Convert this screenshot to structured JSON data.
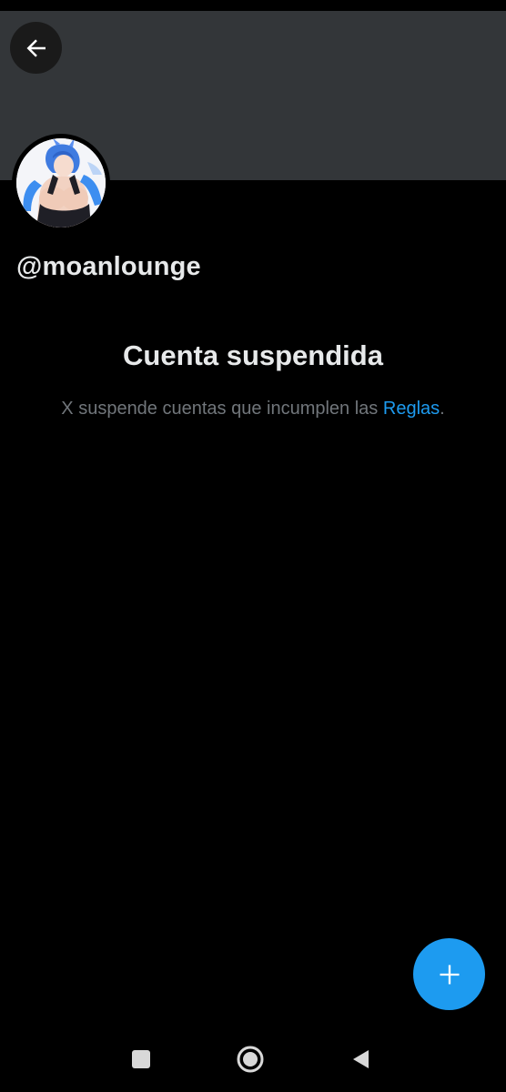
{
  "header": {
    "back_icon": "arrow-left-icon"
  },
  "profile": {
    "handle": "@moanlounge",
    "avatar_icon": "anime-avatar-image"
  },
  "suspension": {
    "title": "Cuenta suspendida",
    "description_prefix": "X suspende cuentas que incumplen las ",
    "rules_link": "Reglas",
    "description_suffix": "."
  },
  "fab": {
    "icon": "plus-icon"
  },
  "system_nav": {
    "recents_icon": "square-icon",
    "home_icon": "circle-icon",
    "back_icon": "triangle-back-icon"
  },
  "colors": {
    "background": "#000000",
    "banner": "#333639",
    "text_primary": "#e7e9ea",
    "text_secondary": "#71767b",
    "accent": "#1d9bf0"
  }
}
